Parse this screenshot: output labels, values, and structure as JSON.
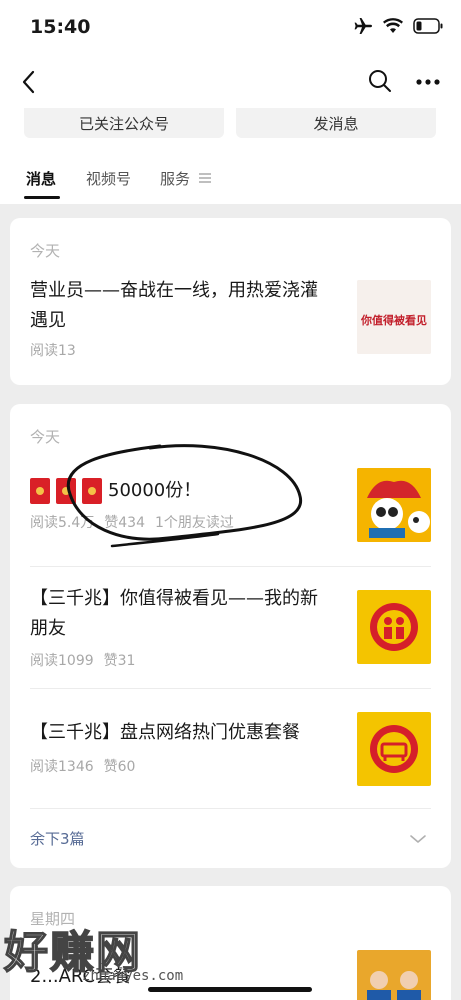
{
  "status_bar": {
    "time": "15:40"
  },
  "follow_strip": {
    "followed_label": "已关注公众号",
    "message_label": "发消息"
  },
  "tabs": [
    {
      "label": "消息"
    },
    {
      "label": "视频号"
    },
    {
      "label": "服务"
    }
  ],
  "cards": [
    {
      "date": "今天",
      "articles": [
        {
          "title": "营业员——奋战在一线，用热爱浇灌遇见",
          "meta": [
            "阅读13"
          ],
          "thumb_text": "你值得被看见"
        }
      ]
    },
    {
      "date": "今天",
      "articles": [
        {
          "title": "50000份！",
          "meta": [
            "阅读5.4万",
            "赞434",
            "1个朋友读过"
          ]
        },
        {
          "title": "【三千兆】你值得被看见——我的新朋友",
          "meta": [
            "阅读1099",
            "赞31"
          ]
        },
        {
          "title": "【三千兆】盘点网络热门优惠套餐",
          "meta": [
            "阅读1346",
            "赞60"
          ]
        }
      ],
      "remaining": "余下3篇"
    },
    {
      "date": "星期四",
      "articles": [
        {
          "title": "2...ARC套餐"
        }
      ]
    }
  ],
  "watermark": {
    "text": "好赚网",
    "sub": "zhuanyes.com"
  },
  "colors": {
    "link": "#576b95",
    "red": "#d92027",
    "gold": "#f4c247"
  }
}
